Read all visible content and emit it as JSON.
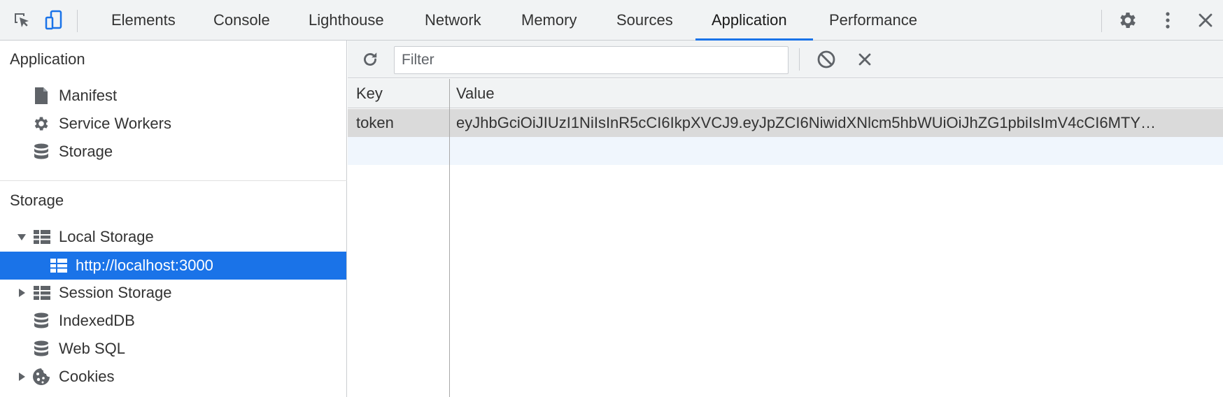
{
  "toolbar": {
    "inspect_icon": "inspect-element-icon",
    "device_icon": "device-toolbar-icon",
    "tabs": [
      {
        "label": "Elements"
      },
      {
        "label": "Console"
      },
      {
        "label": "Lighthouse"
      },
      {
        "label": "Network"
      },
      {
        "label": "Memory"
      },
      {
        "label": "Sources"
      },
      {
        "label": "Application"
      },
      {
        "label": "Performance"
      }
    ],
    "active_tab": "Application",
    "settings_icon": "gear-icon",
    "more_icon": "kebab-menu-icon",
    "close_icon": "close-icon",
    "accent_color": "#1a73e8"
  },
  "sidebar": {
    "application_section": {
      "title": "Application",
      "items": [
        {
          "label": "Manifest",
          "icon": "document-icon"
        },
        {
          "label": "Service Workers",
          "icon": "gear-icon"
        },
        {
          "label": "Storage",
          "icon": "database-icon"
        }
      ]
    },
    "storage_section": {
      "title": "Storage",
      "items": [
        {
          "label": "Local Storage",
          "icon": "table-icon",
          "expanded": true
        },
        {
          "label": "http://localhost:3000",
          "icon": "table-icon",
          "selected": true
        },
        {
          "label": "Session Storage",
          "icon": "table-icon",
          "expanded": false
        },
        {
          "label": "IndexedDB",
          "icon": "database-icon"
        },
        {
          "label": "Web SQL",
          "icon": "database-icon"
        },
        {
          "label": "Cookies",
          "icon": "cookie-icon",
          "expanded": false
        }
      ]
    },
    "selected_color": "#1a73e8"
  },
  "main": {
    "filter": {
      "placeholder": "Filter",
      "value": "",
      "refresh_icon": "refresh-icon",
      "clear_all_icon": "block-icon",
      "delete_icon": "close-icon"
    },
    "table": {
      "columns": [
        "Key",
        "Value"
      ],
      "rows": [
        {
          "key": "token",
          "value": "eyJhbGciOiJIUzI1NiIsInR5cCI6IkpXVCJ9.eyJpZCI6NiwidXNlcm5hbWUiOiJhZG1pbiIsImV4cCI6MTY…"
        }
      ]
    }
  }
}
